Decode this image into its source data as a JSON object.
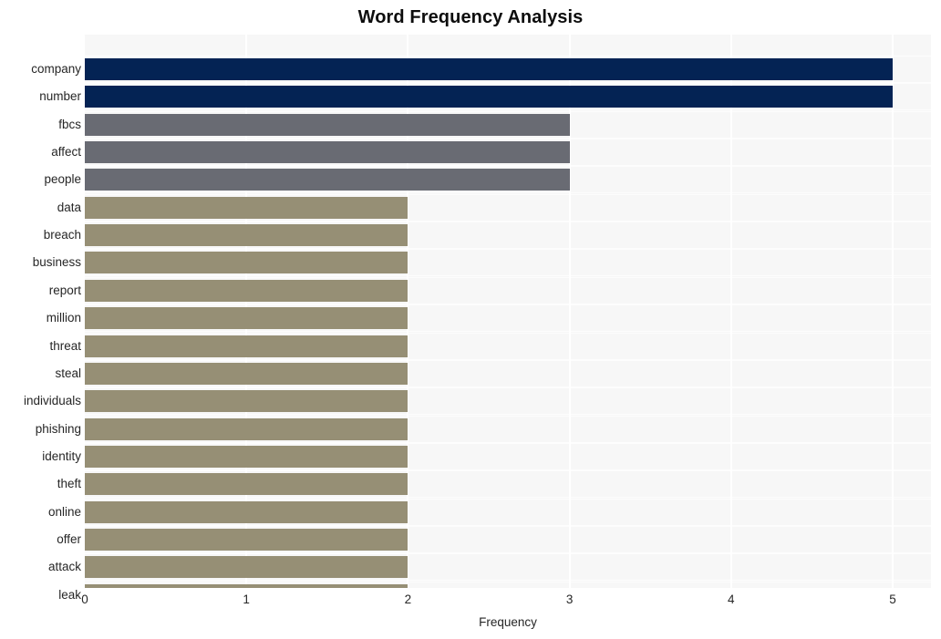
{
  "chart_data": {
    "type": "bar",
    "orientation": "horizontal",
    "title": "Word Frequency Analysis",
    "xlabel": "Frequency",
    "ylabel": "",
    "xlim": [
      0,
      5
    ],
    "ylim": [
      0,
      20
    ],
    "xticks": [
      "0",
      "1",
      "2",
      "3",
      "4",
      "5"
    ],
    "xtick_values": [
      0,
      1,
      2,
      3,
      4,
      5
    ],
    "grid": true,
    "legend": false,
    "categories": [
      "company",
      "number",
      "fbcs",
      "affect",
      "people",
      "data",
      "breach",
      "business",
      "report",
      "million",
      "threat",
      "steal",
      "individuals",
      "phishing",
      "identity",
      "theft",
      "online",
      "offer",
      "attack",
      "leak"
    ],
    "values": [
      5,
      5,
      3,
      3,
      3,
      2,
      2,
      2,
      2,
      2,
      2,
      2,
      2,
      2,
      2,
      2,
      2,
      2,
      2,
      2
    ],
    "bar_colors": [
      "#042354",
      "#042354",
      "#696b73",
      "#696b73",
      "#696b73",
      "#968f75",
      "#968f75",
      "#968f75",
      "#968f75",
      "#968f75",
      "#968f75",
      "#968f75",
      "#968f75",
      "#968f75",
      "#968f75",
      "#968f75",
      "#968f75",
      "#968f75",
      "#968f75",
      "#968f75"
    ],
    "palette": {
      "high": "#042354",
      "medium": "#696b73",
      "low": "#968f75"
    },
    "plot_background": "#f7f7f7",
    "figure_background": "#ffffff",
    "gridline_color": "#ffffff",
    "text_color": "#262626"
  }
}
